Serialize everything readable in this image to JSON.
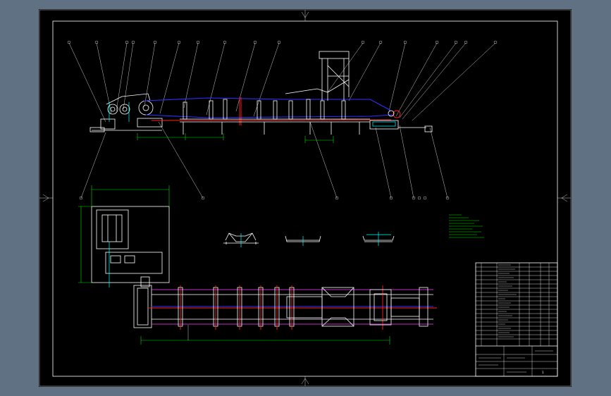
{
  "colors": {
    "viewport_bg": "#607184",
    "sheet_bg": "#000000",
    "line": "#ffffff",
    "belt": "#3030ff",
    "centerline": "#ff2020",
    "dimension": "#00e000",
    "accent": "#00ffff"
  },
  "drawing": {
    "title_block": {
      "scale_note": "1"
    }
  }
}
